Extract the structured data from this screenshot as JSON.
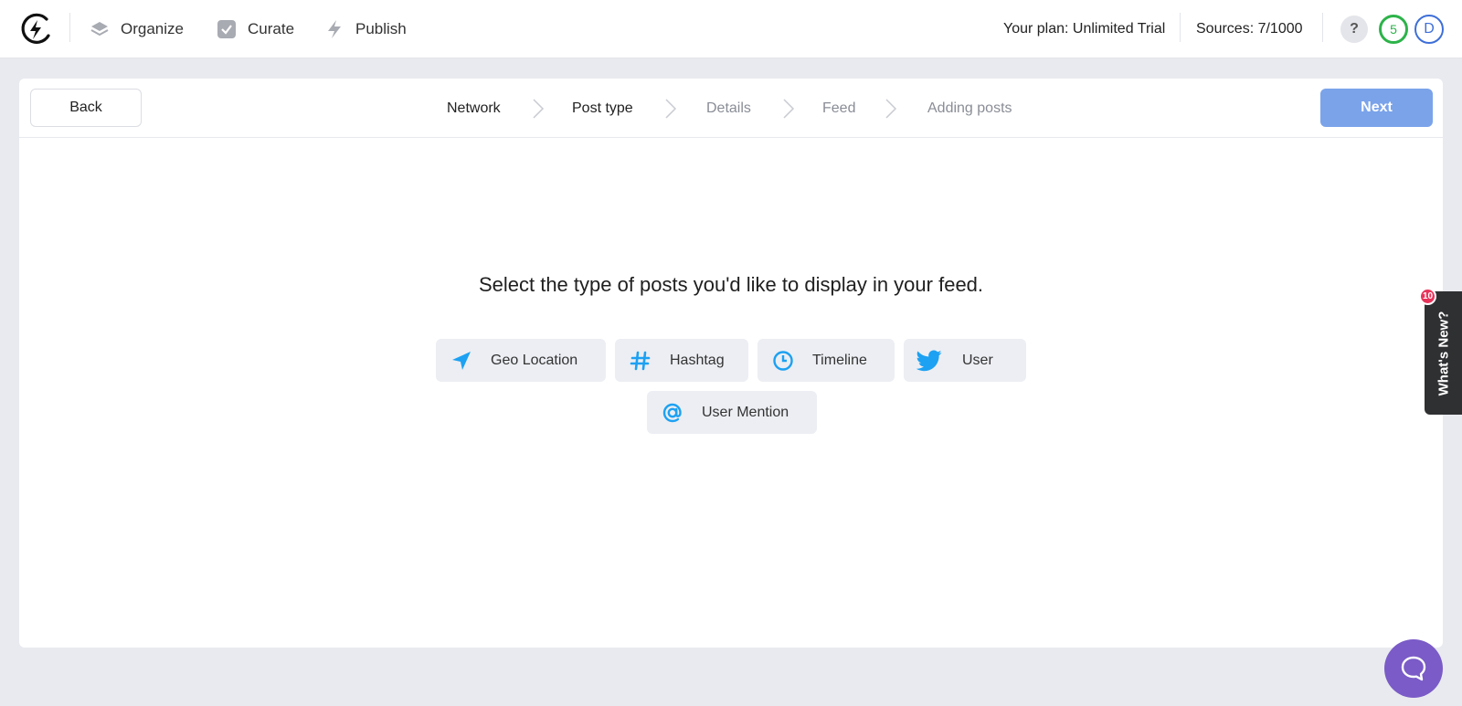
{
  "nav": {
    "items": [
      {
        "label": "Organize",
        "icon": "layers-icon"
      },
      {
        "label": "Curate",
        "icon": "checkbox-icon"
      },
      {
        "label": "Publish",
        "icon": "bolt-icon"
      }
    ],
    "plan": "Your plan: Unlimited Trial",
    "sources": "Sources: 7/1000",
    "help": "?",
    "progress": "5",
    "avatar": "D"
  },
  "header": {
    "back": "Back",
    "next": "Next",
    "steps": [
      {
        "label": "Network",
        "state": "done"
      },
      {
        "label": "Post type",
        "state": "current"
      },
      {
        "label": "Details",
        "state": "todo"
      },
      {
        "label": "Feed",
        "state": "todo"
      },
      {
        "label": "Adding posts",
        "state": "todo"
      }
    ]
  },
  "main": {
    "prompt": "Select the type of posts you'd like to display in your feed.",
    "types": [
      {
        "label": "Geo Location",
        "icon": "location-arrow-icon"
      },
      {
        "label": "Hashtag",
        "icon": "hashtag-icon"
      },
      {
        "label": "Timeline",
        "icon": "clock-icon"
      },
      {
        "label": "User",
        "icon": "twitter-bird-icon"
      },
      {
        "label": "User Mention",
        "icon": "at-sign-icon"
      }
    ]
  },
  "whats_new": {
    "label": "What's New?",
    "badge": "10"
  },
  "colors": {
    "accent": "#1da1f2",
    "next_button": "#7aa3ea",
    "chat": "#7a5bc7",
    "badge": "#e8335a"
  }
}
